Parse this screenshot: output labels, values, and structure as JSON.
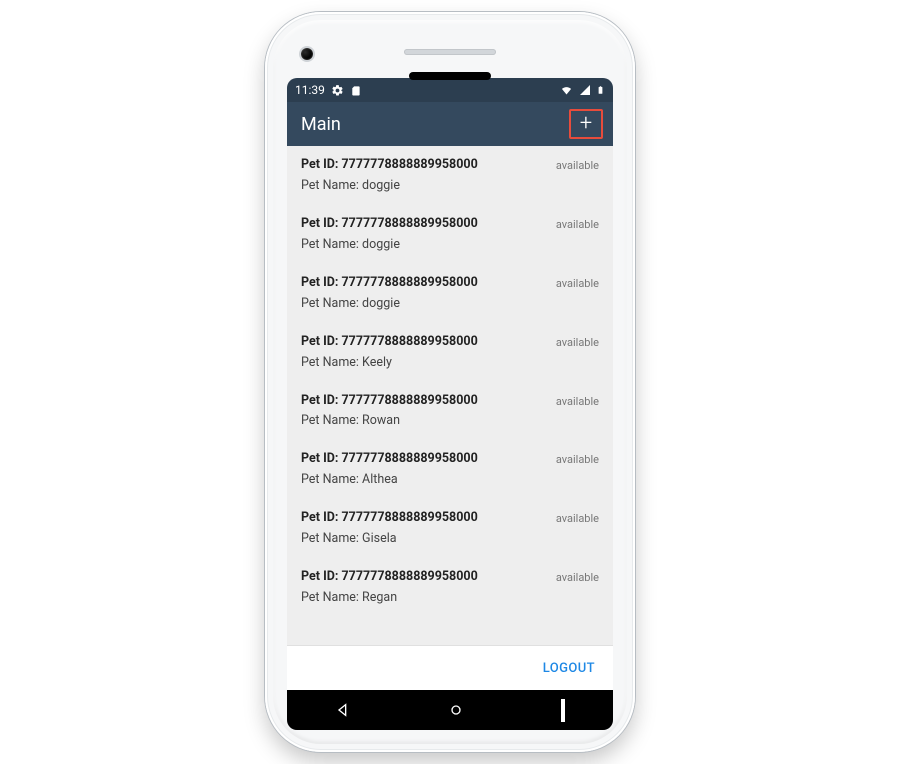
{
  "status_bar": {
    "time": "11:39",
    "icons_left": [
      "gear",
      "sim"
    ],
    "icons_right": [
      "wifi",
      "signal",
      "battery"
    ]
  },
  "app_bar": {
    "title": "Main",
    "add_highlight": true
  },
  "list": {
    "id_label": "Pet ID:",
    "name_label": "Pet Name:",
    "items": [
      {
        "id": "7777778888889958000",
        "name": "doggie",
        "status": "available"
      },
      {
        "id": "7777778888889958000",
        "name": "doggie",
        "status": "available"
      },
      {
        "id": "7777778888889958000",
        "name": "doggie",
        "status": "available"
      },
      {
        "id": "7777778888889958000",
        "name": "Keely",
        "status": "available"
      },
      {
        "id": "7777778888889958000",
        "name": "Rowan",
        "status": "available"
      },
      {
        "id": "7777778888889958000",
        "name": "Althea",
        "status": "available"
      },
      {
        "id": "7777778888889958000",
        "name": "Gisela",
        "status": "available"
      },
      {
        "id": "7777778888889958000",
        "name": "Regan",
        "status": "available"
      }
    ]
  },
  "footer": {
    "logout_label": "LOGOUT"
  }
}
